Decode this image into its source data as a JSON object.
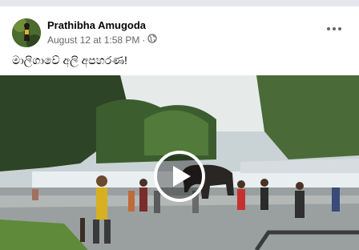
{
  "post": {
    "author": "Prathibha Amugoda",
    "date": "August 12 at 1:58 PM",
    "separator": "·",
    "privacy_icon": "globe-icon",
    "more_icon": "ellipsis-icon",
    "caption": "මාලිගාවේ අලි අපහරණ!"
  },
  "video": {
    "play_icon": "play-icon"
  },
  "colors": {
    "author_text": "#050505",
    "meta_text": "#65676b",
    "background": "#f0f2f5"
  }
}
